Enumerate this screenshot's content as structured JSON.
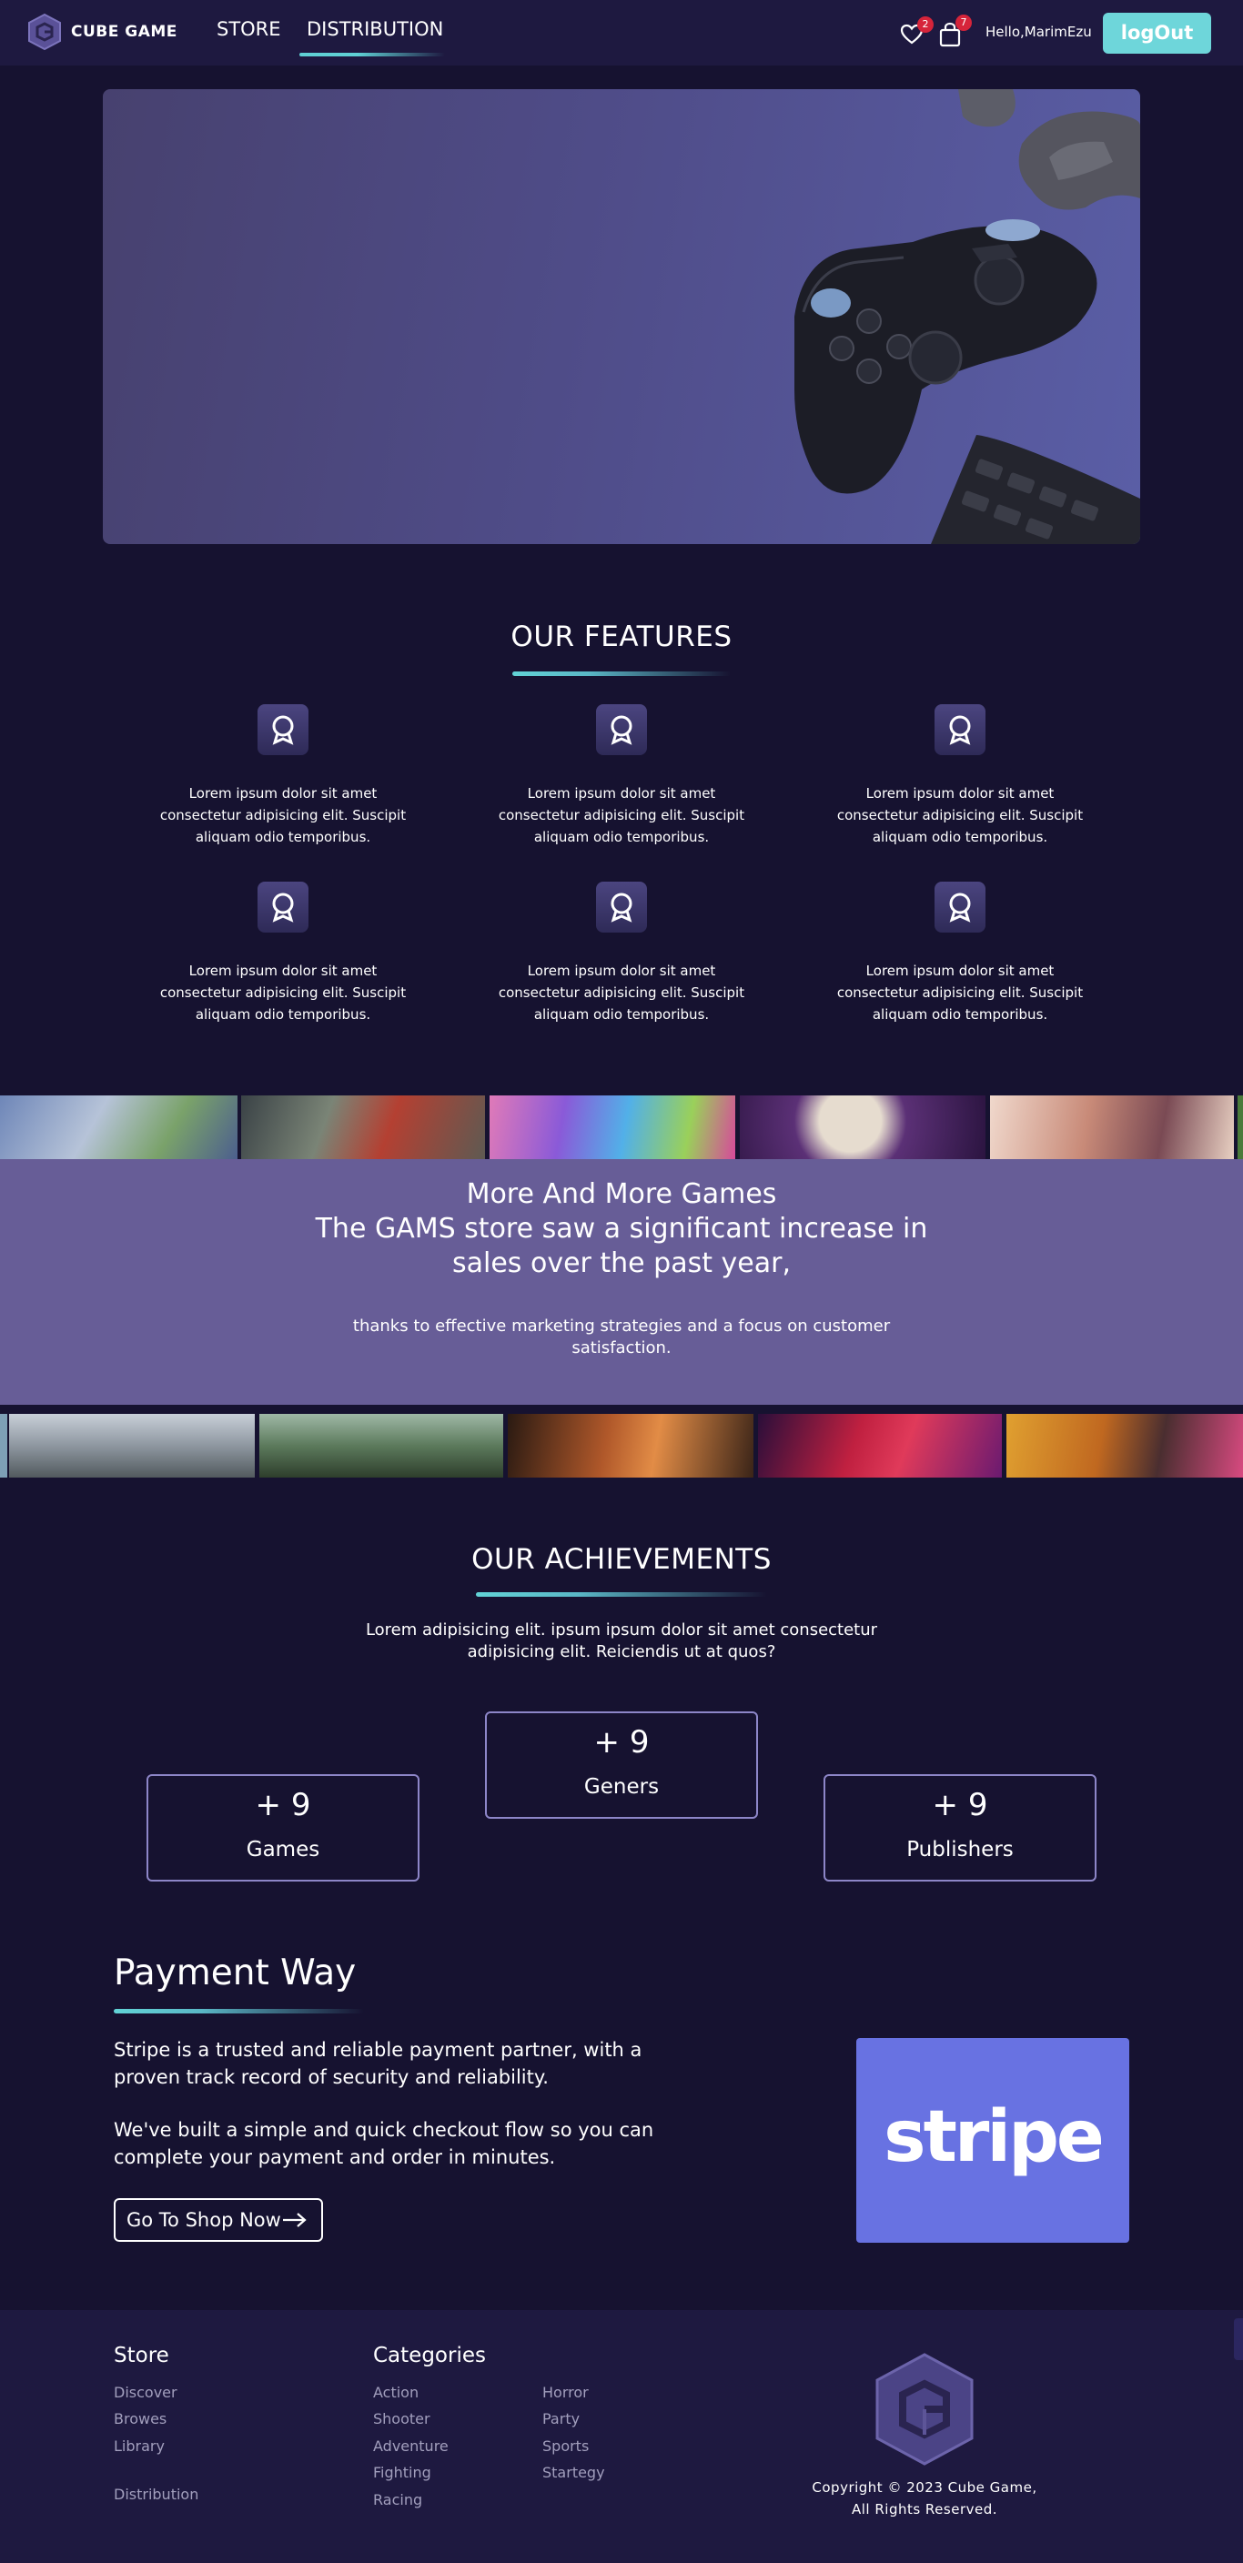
{
  "header": {
    "brand": "CUBE GAME",
    "nav": [
      {
        "label": "STORE"
      },
      {
        "label": "DISTRIBUTION"
      }
    ],
    "wishlist_count": "2",
    "cart_count": "7",
    "greeting": "Hello,MarimEzu",
    "logout_label": "logOut"
  },
  "features": {
    "title": "OUR FEATURES",
    "items": [
      {
        "text": "Lorem ipsum dolor sit amet consectetur adipisicing elit. Suscipit aliquam odio temporibus."
      },
      {
        "text": "Lorem ipsum dolor sit amet consectetur adipisicing elit. Suscipit aliquam odio temporibus."
      },
      {
        "text": "Lorem ipsum dolor sit amet consectetur adipisicing elit. Suscipit aliquam odio temporibus."
      },
      {
        "text": "Lorem ipsum dolor sit amet consectetur adipisicing elit. Suscipit aliquam odio temporibus."
      },
      {
        "text": "Lorem ipsum dolor sit amet consectetur adipisicing elit. Suscipit aliquam odio temporibus."
      },
      {
        "text": "Lorem ipsum dolor sit amet consectetur adipisicing elit. Suscipit aliquam odio temporibus."
      }
    ]
  },
  "promo": {
    "title_line1": "More And More Games",
    "title_line2": "The GAMS store saw a significant increase in",
    "title_line3": "sales over the past year,",
    "subtitle": "thanks to effective marketing strategies and a focus on customer satisfaction."
  },
  "achievements": {
    "title": "OUR ACHIEVEMENTS",
    "description": "Lorem adipisicing elit. ipsum ipsum dolor sit amet consectetur adipisicing elit. Reiciendis ut at quos?",
    "stats": [
      {
        "value": "+ 9",
        "label": "Games"
      },
      {
        "value": "+ 9",
        "label": "Geners"
      },
      {
        "value": "+ 9",
        "label": "Publishers"
      }
    ]
  },
  "payment": {
    "title": "Payment Way",
    "paragraph1": "Stripe is a trusted and reliable payment partner, with a proven track record of security and reliability.",
    "paragraph2": "We've built a simple and quick checkout flow so you can complete your payment and order in minutes.",
    "button_label": "Go To Shop Now",
    "provider_logo_text": "stripe"
  },
  "footer": {
    "store_heading": "Store",
    "store_links": [
      "Discover",
      "Browes",
      "Library"
    ],
    "distribution_link": "Distribution",
    "categories_heading": "Categories",
    "categories_col1": [
      "Action",
      "Shooter",
      "Adventure",
      "Fighting",
      "Racing"
    ],
    "categories_col2": [
      "Horror",
      "Party",
      "Sports",
      "Startegy"
    ],
    "copyright_line1": "Copyright © 2023 Cube Game,",
    "copyright_line2": "All Rights Reserved."
  },
  "colors": {
    "background": "#161230",
    "header_bg": "#1e1940",
    "accent_cyan": "#6ed6da",
    "band_purple": "#675d97",
    "stat_border": "#8d86c8",
    "stripe_blue": "#6872e2",
    "badge_red": "#d6243a"
  }
}
